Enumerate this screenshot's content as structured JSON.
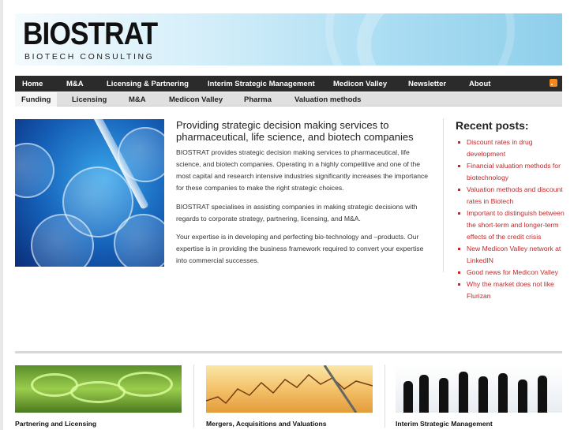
{
  "header": {
    "logo": "BIOSTRAT",
    "tagline": "BIOTECH CONSULTING"
  },
  "nav_primary": [
    {
      "label": "Home"
    },
    {
      "label": "M&A"
    },
    {
      "label": "Licensing & Partnering"
    },
    {
      "label": "Interim Strategic Management"
    },
    {
      "label": "Medicon Valley"
    },
    {
      "label": "Newsletter"
    },
    {
      "label": "About"
    }
  ],
  "nav_secondary": [
    {
      "label": "Funding"
    },
    {
      "label": "Licensing"
    },
    {
      "label": "M&A"
    },
    {
      "label": "Medicon Valley"
    },
    {
      "label": "Pharma"
    },
    {
      "label": "Valuation methods"
    }
  ],
  "main": {
    "title": "Providing strategic decision making services to pharmaceutical, life science, and biotech companies",
    "paragraphs": [
      "BIOSTRAT provides strategic decision making services to pharmaceutical, life science, and biotech companies. Operating in a highly competitive and one of the most capital and research intensive industries significantly increases the importance for these companies to make the right strategic choices.",
      "BIOSTRAT specialises in assisting companies in making strategic decisions with regards to corporate strategy, partnering, licensing, and M&A.",
      "Your expertise is in developing and perfecting bio-technology and –products. Our expertise is in providing the business framework required to convert your expertise into commercial successes."
    ]
  },
  "sidebar": {
    "title": "Recent posts:",
    "posts": [
      "Discount rates in drug development",
      "Financial valuation methods for biotechnology",
      "Valuation methods and discount rates in Biotech",
      "Important to distinguish between the short-term and longer-term effects of the credit crisis",
      "New Medicon Valley network at LinkedIN",
      "Good news for Medicon Valley",
      "Why the market does not like Flurizan"
    ]
  },
  "tiles": [
    {
      "caption": "Partnering and Licensing"
    },
    {
      "caption": "Mergers, Acquisitions and Valuations"
    },
    {
      "caption": "Interim Strategic Management"
    }
  ],
  "colors": {
    "nav_bg": "#2b2b2b",
    "link_red": "#c0292b",
    "rss_orange": "#f2891e"
  }
}
